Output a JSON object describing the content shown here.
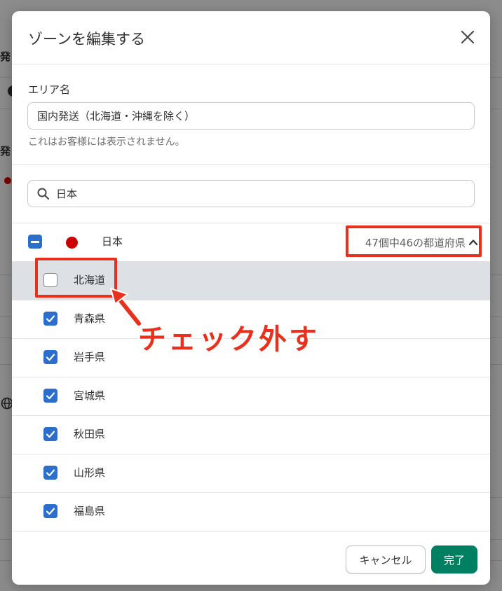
{
  "background": {
    "partial_texts": [
      "発",
      "発"
    ]
  },
  "modal": {
    "title": "ゾーンを編集する",
    "area": {
      "label": "エリア名",
      "value": "国内発送（北海道・沖縄を除く）",
      "help": "これはお客様には表示されません。"
    },
    "search": {
      "value": "日本"
    },
    "country": {
      "name": "日本",
      "flag_color": "#cc0000",
      "count_text": "47個中46の都道府県",
      "state": "indeterminate"
    },
    "prefectures": [
      {
        "name": "北海道",
        "checked": false
      },
      {
        "name": "青森県",
        "checked": true
      },
      {
        "name": "岩手県",
        "checked": true
      },
      {
        "name": "宮城県",
        "checked": true
      },
      {
        "name": "秋田県",
        "checked": true
      },
      {
        "name": "山形県",
        "checked": true
      },
      {
        "name": "福島県",
        "checked": true
      }
    ],
    "footer": {
      "cancel": "キャンセル",
      "done": "完了"
    }
  },
  "annotation": {
    "text": "チェック外す",
    "color": "#e8301c"
  },
  "colors": {
    "checkbox_blue": "#2c6ecb",
    "primary_green": "#008060"
  }
}
